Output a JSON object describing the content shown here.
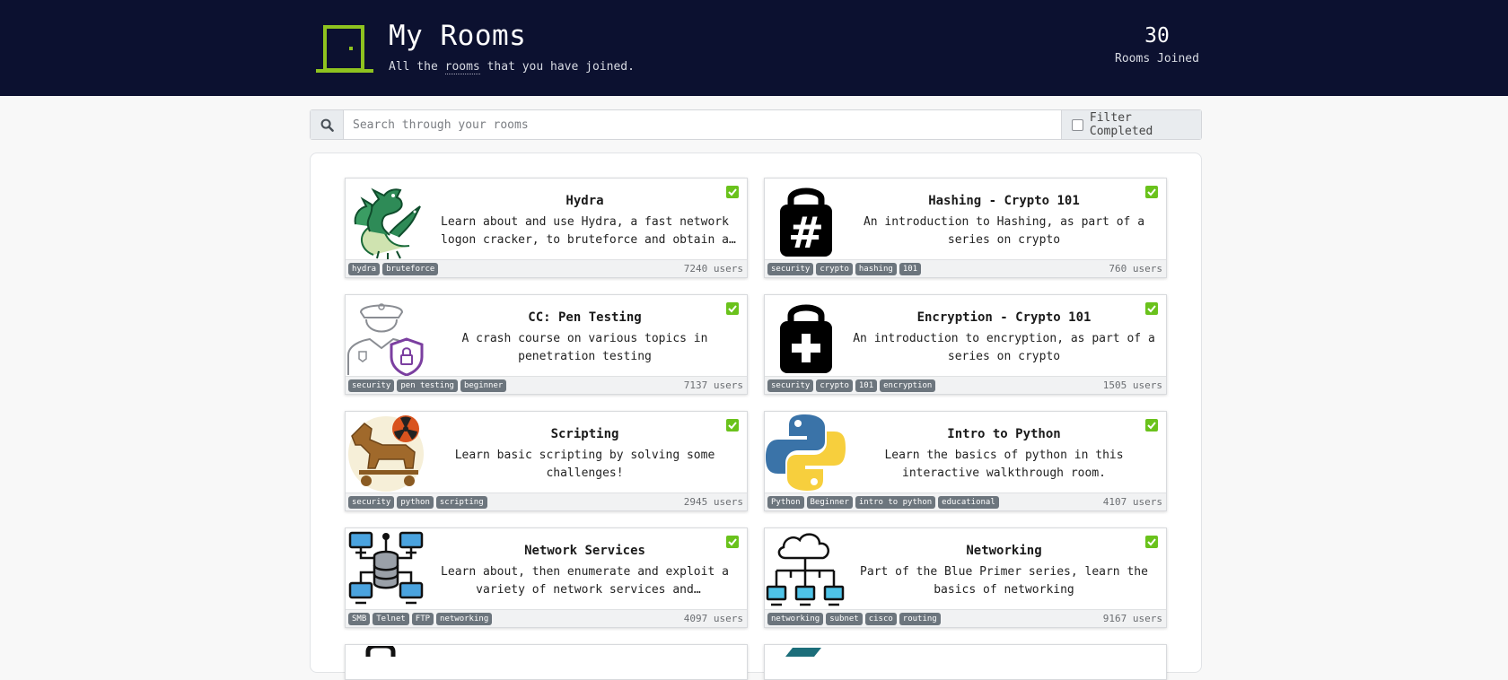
{
  "header": {
    "title": "My Rooms",
    "subtitle_prefix": "All the ",
    "subtitle_link": "rooms",
    "subtitle_suffix": " that you have joined.",
    "rooms_joined_count": "30",
    "rooms_joined_label": "Rooms Joined",
    "accent_color": "#8fc31f"
  },
  "search": {
    "placeholder": "Search through your rooms",
    "value": "",
    "filter_label": "Filter Completed",
    "filter_checked": false
  },
  "rooms": [
    {
      "name": "Hydra",
      "description": "Learn about and use Hydra, a fast network logon cracker, to bruteforce and obtain a website's credentials.",
      "tags": [
        "hydra",
        "bruteforce"
      ],
      "users": "7240 users",
      "completed": true,
      "icon": "hydra-icon"
    },
    {
      "name": "Hashing - Crypto 101",
      "description": "An introduction to Hashing, as part of a series on crypto",
      "tags": [
        "security",
        "crypto",
        "hashing",
        "101"
      ],
      "users": "760 users",
      "completed": true,
      "icon": "hash-lock-icon"
    },
    {
      "name": "CC: Pen Testing",
      "description": "A crash course on various topics in penetration testing",
      "tags": [
        "security",
        "pen testing",
        "beginner"
      ],
      "users": "7137 users",
      "completed": true,
      "icon": "security-guard-icon"
    },
    {
      "name": "Encryption - Crypto 101",
      "description": "An introduction to encryption, as part of a series on crypto",
      "tags": [
        "security",
        "crypto",
        "101",
        "encryption"
      ],
      "users": "1505 users",
      "completed": true,
      "icon": "plus-lock-icon"
    },
    {
      "name": "Scripting",
      "description": "Learn basic scripting by solving some challenges!",
      "tags": [
        "security",
        "python",
        "scripting"
      ],
      "users": "2945 users",
      "completed": true,
      "icon": "trojan-horse-icon"
    },
    {
      "name": "Intro to Python",
      "description": "Learn the basics of python in this interactive walkthrough room.",
      "tags": [
        "Python",
        "Beginner",
        "intro to python",
        "educational"
      ],
      "users": "4107 users",
      "completed": true,
      "icon": "python-logo-icon"
    },
    {
      "name": "Network Services",
      "description": "Learn about, then enumerate and exploit a variety of network services and misconfigurations.",
      "tags": [
        "SMB",
        "Telnet",
        "FTP",
        "networking"
      ],
      "users": "4097 users",
      "completed": true,
      "icon": "network-database-icon"
    },
    {
      "name": "Networking",
      "description": "Part of the Blue Primer series, learn the basics of networking",
      "tags": [
        "networking",
        "subnet",
        "cisco",
        "routing"
      ],
      "users": "9167 users",
      "completed": true,
      "icon": "cloud-network-icon"
    }
  ]
}
